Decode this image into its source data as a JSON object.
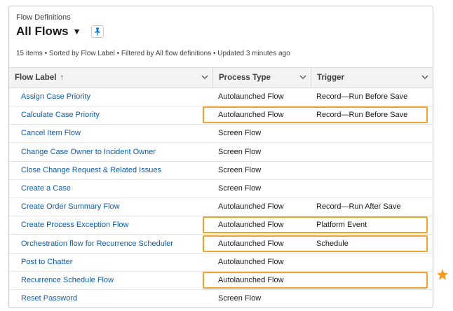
{
  "header": {
    "subtitle": "Flow Definitions",
    "title": "All Flows",
    "caret": "▼"
  },
  "info_text": "15 items • Sorted by Flow Label • Filtered by All flow definitions • Updated 3 minutes ago",
  "columns": [
    {
      "label": "Flow Label",
      "sort_indicator": "↑"
    },
    {
      "label": "Process Type"
    },
    {
      "label": "Trigger"
    }
  ],
  "rows": [
    {
      "label": "Assign Case Priority",
      "process_type": "Autolaunched Flow",
      "trigger": "Record—Run Before Save",
      "highlighted": false
    },
    {
      "label": "Calculate Case Priority",
      "process_type": "Autolaunched Flow",
      "trigger": "Record—Run Before Save",
      "highlighted": true
    },
    {
      "label": "Cancel Item Flow",
      "process_type": "Screen Flow",
      "trigger": "",
      "highlighted": false
    },
    {
      "label": "Change Case Owner to Incident Owner",
      "process_type": "Screen Flow",
      "trigger": "",
      "highlighted": false
    },
    {
      "label": "Close Change Request & Related Issues",
      "process_type": "Screen Flow",
      "trigger": "",
      "highlighted": false
    },
    {
      "label": "Create a Case",
      "process_type": "Screen Flow",
      "trigger": "",
      "highlighted": false
    },
    {
      "label": "Create Order Summary Flow",
      "process_type": "Autolaunched Flow",
      "trigger": "Record—Run After Save",
      "highlighted": false
    },
    {
      "label": "Create Process Exception Flow",
      "process_type": "Autolaunched Flow",
      "trigger": "Platform Event",
      "highlighted": true
    },
    {
      "label": "Orchestration flow for Recurrence Scheduler",
      "process_type": "Autolaunched Flow",
      "trigger": "Schedule",
      "highlighted": true
    },
    {
      "label": "Post to Chatter",
      "process_type": "Autolaunched Flow",
      "trigger": "",
      "highlighted": false
    },
    {
      "label": "Recurrence Schedule Flow",
      "process_type": "Autolaunched Flow",
      "trigger": "",
      "highlighted": true
    },
    {
      "label": "Reset Password",
      "process_type": "Screen Flow",
      "trigger": "",
      "highlighted": false
    }
  ],
  "colors": {
    "link": "#0b5cab",
    "highlight_border": "#f0a32a",
    "star": "#f29b1d",
    "pin": "#0176d3"
  },
  "icons": {
    "pin": "pin-icon",
    "column_menu": "chevron-down-icon",
    "marker": "star-icon"
  }
}
